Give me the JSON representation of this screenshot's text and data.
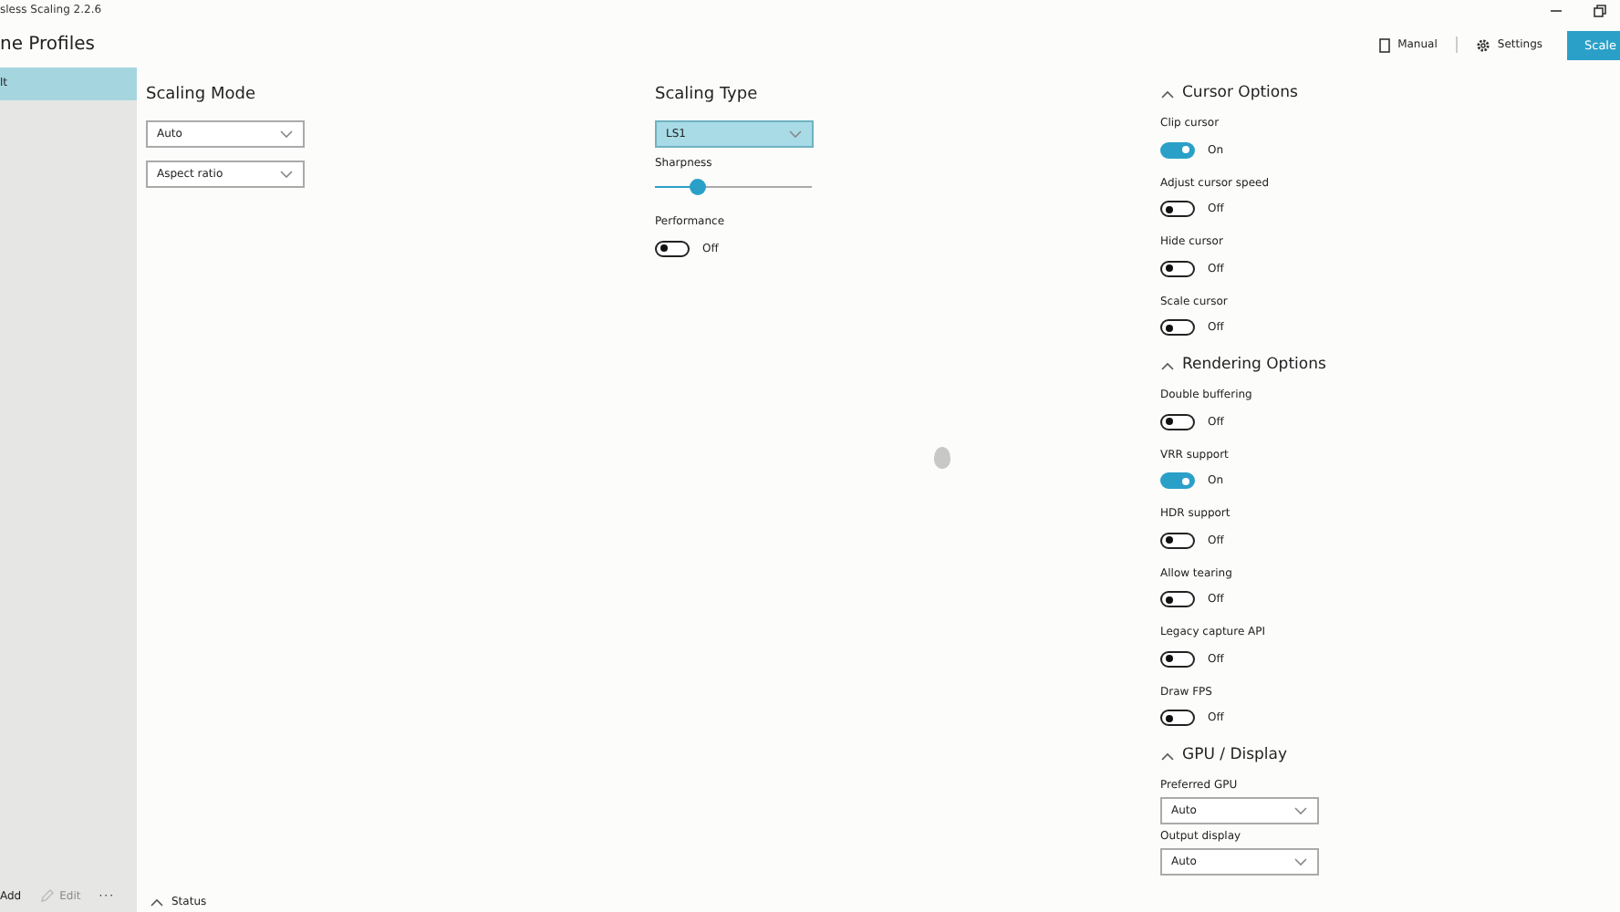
{
  "window": {
    "title": "sless Scaling 2.2.6"
  },
  "header": {
    "title": "ne Profiles"
  },
  "toolbar": [
    {
      "label": "Manual",
      "kind": "manual"
    },
    {
      "label": "Settings",
      "kind": "settings"
    },
    {
      "label": "Scale",
      "kind": "primary"
    }
  ],
  "sidebar": {
    "profiles": [
      {
        "label": "lt",
        "selected": true
      }
    ],
    "actions": [
      {
        "label": "Add",
        "kind": "add",
        "disabled": false
      },
      {
        "label": "Edit",
        "kind": "edit",
        "disabled": true
      },
      {
        "label": "···",
        "kind": "more",
        "disabled": false
      }
    ]
  },
  "scaling_mode": {
    "heading": "Scaling Mode",
    "dropdowns": [
      {
        "value": "Auto"
      },
      {
        "value": "Aspect ratio"
      }
    ]
  },
  "scaling_type": {
    "heading": "Scaling Type",
    "dropdown": {
      "value": "LS1",
      "highlighted": true
    },
    "sharpness": {
      "label": "Sharpness",
      "level": 0.27
    },
    "performance": {
      "label": "Performance",
      "on": false,
      "state_text": "Off"
    }
  },
  "sections": [
    {
      "title": "Cursor Options",
      "expanded": true,
      "items": [
        {
          "kind": "toggle",
          "label": "Clip cursor",
          "on": true,
          "state_text": "On"
        },
        {
          "kind": "toggle",
          "label": "Adjust cursor speed",
          "on": false,
          "state_text": "Off"
        },
        {
          "kind": "toggle",
          "label": "Hide cursor",
          "on": false,
          "state_text": "Off"
        },
        {
          "kind": "toggle",
          "label": "Scale cursor",
          "on": false,
          "state_text": "Off"
        }
      ]
    },
    {
      "title": "Rendering Options",
      "expanded": true,
      "items": [
        {
          "kind": "toggle",
          "label": "Double buffering",
          "on": false,
          "state_text": "Off"
        },
        {
          "kind": "toggle",
          "label": "VRR support",
          "on": true,
          "state_text": "On"
        },
        {
          "kind": "toggle",
          "label": "HDR support",
          "on": false,
          "state_text": "Off"
        },
        {
          "kind": "toggle",
          "label": "Allow tearing",
          "on": false,
          "state_text": "Off"
        },
        {
          "kind": "toggle",
          "label": "Legacy capture API",
          "on": false,
          "state_text": "Off"
        },
        {
          "kind": "toggle",
          "label": "Draw FPS",
          "on": false,
          "state_text": "Off"
        }
      ]
    },
    {
      "title": "GPU / Display",
      "expanded": true,
      "items": [
        {
          "kind": "dropdown",
          "label": "Preferred GPU",
          "value": "Auto"
        },
        {
          "kind": "dropdown",
          "label": "Output display",
          "value": "Auto"
        }
      ]
    }
  ],
  "status": {
    "label": "Status",
    "expanded": false
  }
}
